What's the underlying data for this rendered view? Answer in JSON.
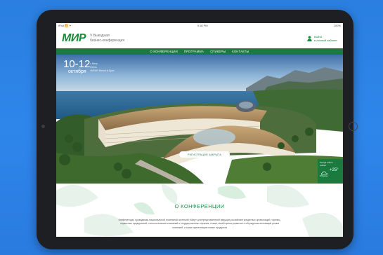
{
  "status_bar": {
    "left": "iPad 📶 ✦",
    "time": "9:18 PM",
    "right": "100%"
  },
  "brand": {
    "logo": "МИР",
    "tagline_line1": "V Выездная",
    "tagline_line2": "бизнес-конференция"
  },
  "login": {
    "line1": "Войти",
    "line2": "в личный кабинет"
  },
  "nav": {
    "items": [
      "О КОНФЕРЕНЦИИ",
      "ПРОГРАММА",
      "СПИКЕРЫ",
      "КОНТАКТЫ"
    ]
  },
  "hero": {
    "date_range": "10-12",
    "month": "октября",
    "location_line1": "г. Ялта",
    "location_line2": "Отель",
    "location_line3": "«МРИЯ Resort & Spa»",
    "register_button": "РЕГИСТРАЦИЯ ЗАКРЫТА"
  },
  "weather": {
    "caption_line1": "Погода в Ялте",
    "caption_line2": "сейчас",
    "temperature": "+25°",
    "condition": "Облачно"
  },
  "about": {
    "title": "О КОНФЕРЕНЦИИ",
    "text": "Конференция, проводимая национальной платежной системой «Мир» для представителей ведущих российских кредитных организаций, торгово-сервисных предприятий, технологических компаний и государственных органов, ставит своей целью развитие и обсуждение инноваций рынка платежей, а также презентацию новых продуктов"
  },
  "colors": {
    "brand_green": "#1b7a3e",
    "background_blue": "#2f86ea",
    "tablet_frame": "#1d1f22"
  }
}
